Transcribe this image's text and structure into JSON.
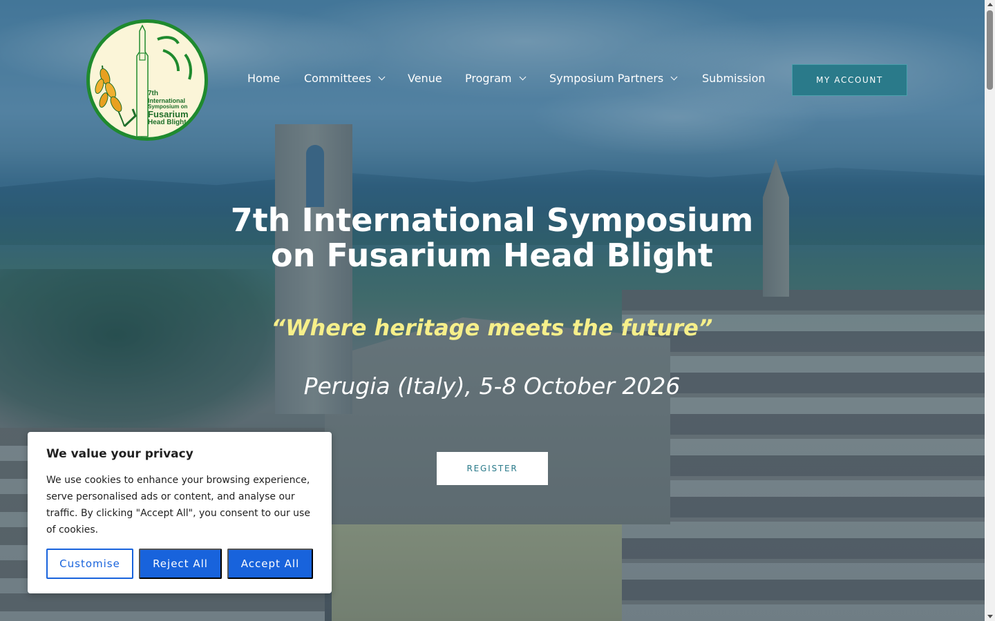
{
  "logo": {
    "line1": "7th",
    "line2": "International",
    "line3": "Symposium on",
    "line4": "Fusarium",
    "line5": "Head Blight",
    "colors": {
      "ring": "#1f8a2e",
      "background": "#fbf5d8",
      "wheat": "#e8a020"
    }
  },
  "nav": {
    "items": [
      {
        "label": "Home",
        "has_dropdown": false
      },
      {
        "label": "Committees",
        "has_dropdown": true
      },
      {
        "label": "Venue",
        "has_dropdown": false
      },
      {
        "label": "Program",
        "has_dropdown": true
      },
      {
        "label": "Symposium Partners",
        "has_dropdown": true
      },
      {
        "label": "Submission",
        "has_dropdown": false
      }
    ],
    "account_label": "MY ACCOUNT"
  },
  "hero": {
    "title_line1": "7th International Symposium",
    "title_line2": "on Fusarium Head Blight",
    "tagline": "“Where heritage meets the future”",
    "dates": "Perugia (Italy), 5-8 October 2026",
    "register_label": "REGISTER"
  },
  "cookie": {
    "heading": "We value your privacy",
    "body": "We use cookies to enhance your browsing experience, serve personalised ads or content, and analyse our traffic. By clicking \"Accept All\", you consent to our use of cookies.",
    "customise_label": "Customise",
    "reject_label": "Reject All",
    "accept_label": "Accept All",
    "accent_color": "#1863dc"
  },
  "theme": {
    "account_button_color": "#2a7a8a",
    "tagline_color": "#f6ef8a"
  }
}
